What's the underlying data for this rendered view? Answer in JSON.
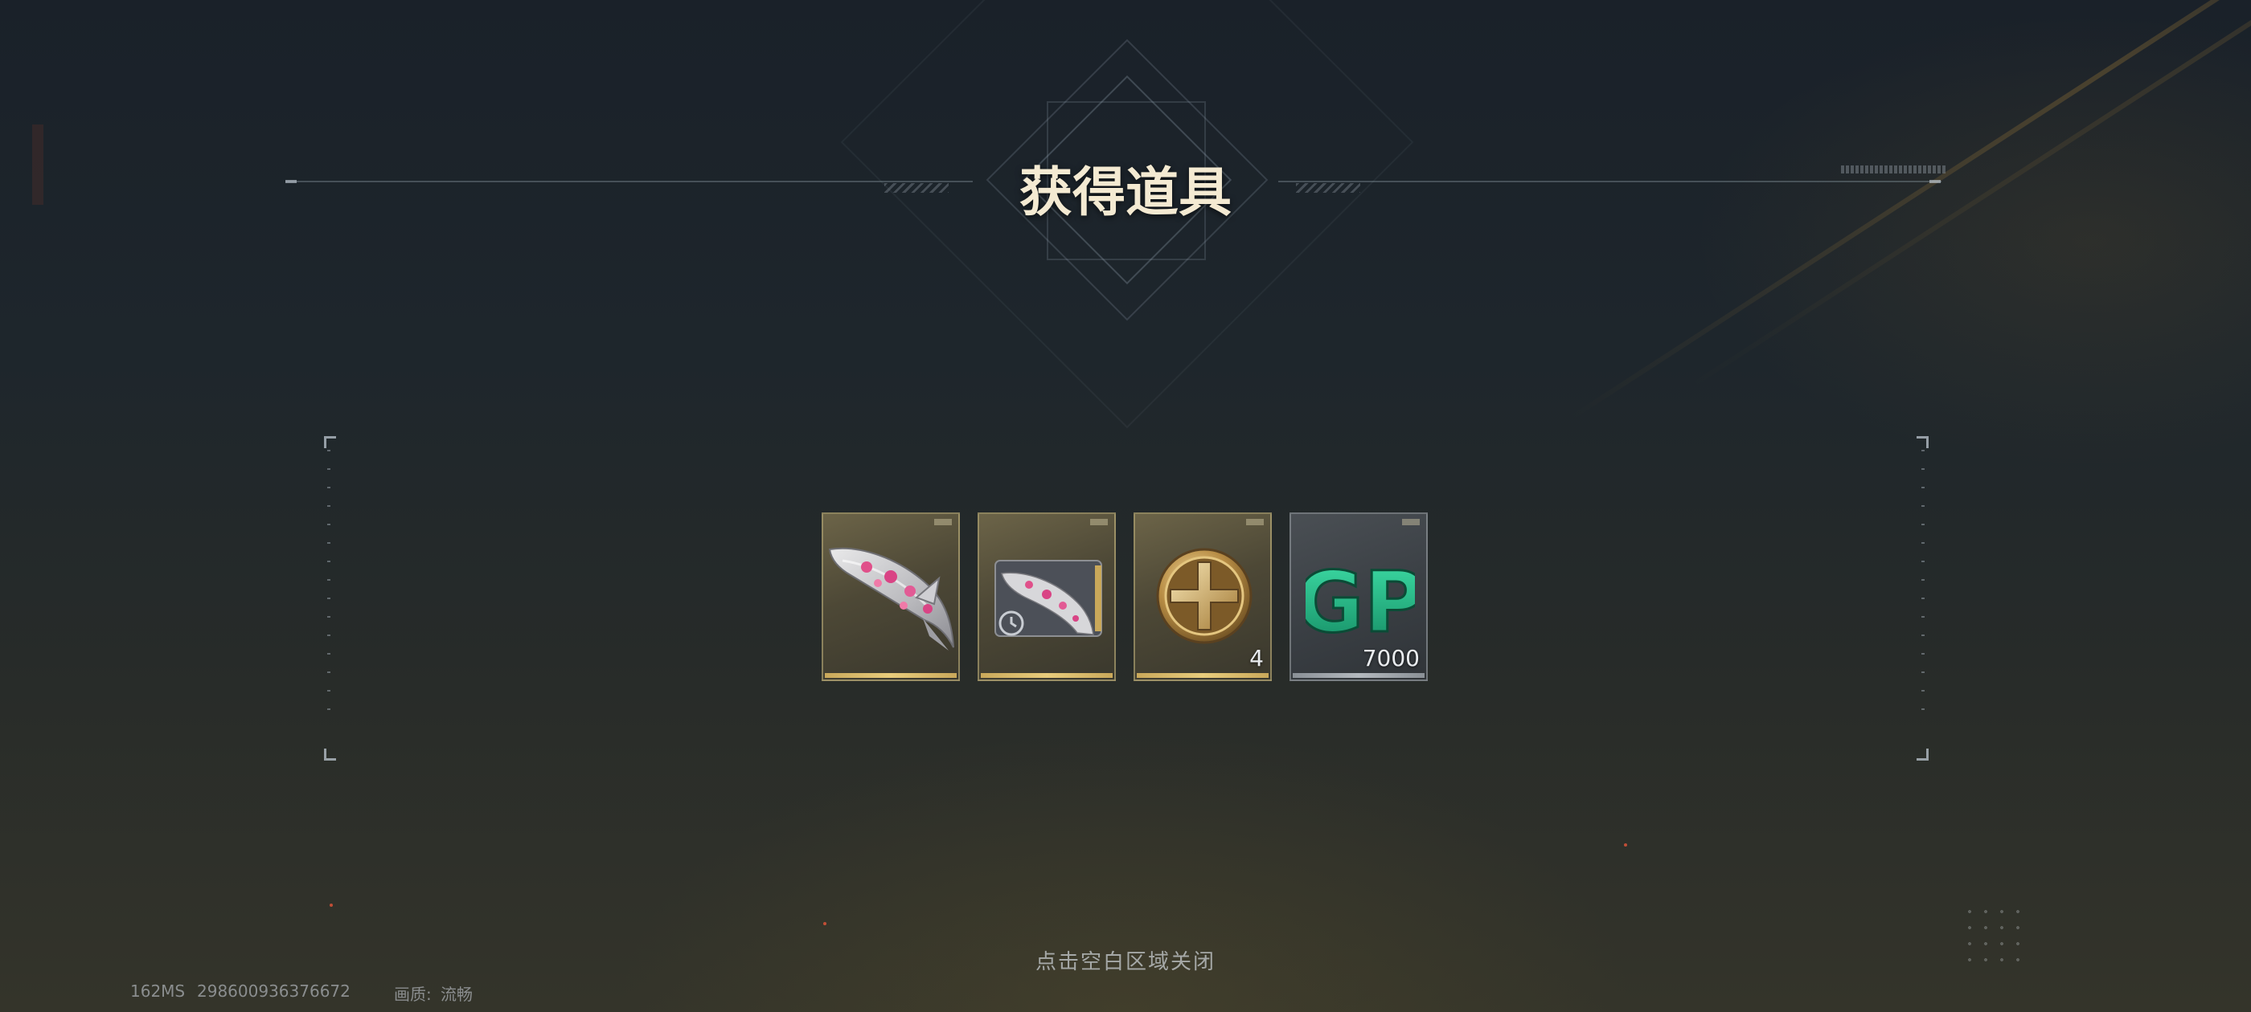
{
  "dialog": {
    "title": "获得道具",
    "close_hint": "点击空白区域关闭"
  },
  "items": [
    {
      "name": "pink-white-blade-weapon",
      "rarity": "gold",
      "quantity": ""
    },
    {
      "name": "weapon-trial-card",
      "rarity": "gold",
      "quantity": ""
    },
    {
      "name": "gold-cross-coin",
      "rarity": "gold",
      "quantity": "4"
    },
    {
      "name": "gp-currency",
      "rarity": "gray",
      "quantity": "7000",
      "label": "GP"
    }
  ],
  "status_bar": {
    "ping": "162MS",
    "uid": "298600936376672",
    "quality_label": "画质:",
    "quality_value": "流畅"
  },
  "colors": {
    "title": "#f4ead2",
    "gold_border": "#c9a85a",
    "gp_green": "#23c08a"
  },
  "icons": {
    "trial_clock": "clock-icon",
    "coin": "cross-coin-icon"
  }
}
